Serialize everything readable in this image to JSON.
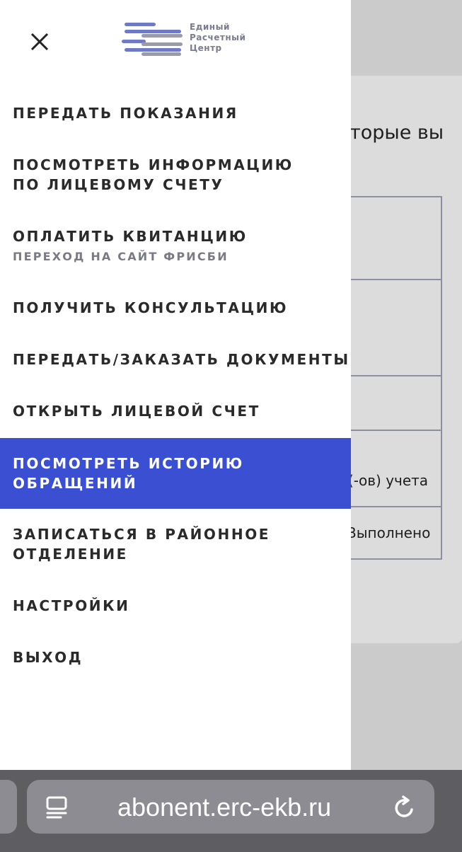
{
  "background": {
    "partial_text": "торые вы",
    "cells": [
      "(-ов) учета",
      "Выполнено"
    ]
  },
  "logo": {
    "line1": "Единый",
    "line2": "Расчетный",
    "line3": "Центр"
  },
  "menu": {
    "items": [
      {
        "label": "ПЕРЕДАТЬ ПОКАЗАНИЯ"
      },
      {
        "label": "ПОСМОТРЕТЬ ИНФОРМАЦИЮ ПО ЛИЦЕВОМУ СЧЕТУ"
      },
      {
        "label": "ОПЛАТИТЬ КВИТАНЦИЮ",
        "sub": "ПЕРЕХОД НА САЙТ ФРИСБИ"
      },
      {
        "label": "ПОЛУЧИТЬ КОНСУЛЬТАЦИЮ"
      },
      {
        "label": "ПЕРЕДАТЬ/ЗАКАЗАТЬ ДОКУМЕНТЫ"
      },
      {
        "label": "ОТКРЫТЬ ЛИЦЕВОЙ СЧЕТ"
      },
      {
        "label": "ПОСМОТРЕТЬ ИСТОРИЮ ОБРАЩЕНИЙ",
        "active": true
      },
      {
        "label": "ЗАПИСАТЬСЯ В РАЙОННОЕ ОТДЕЛЕНИЕ"
      },
      {
        "label": "НАСТРОЙКИ"
      },
      {
        "label": "ВЫХОД"
      }
    ]
  },
  "browser": {
    "url": "abonent.erc-ekb.ru"
  },
  "colors": {
    "active_item": "#3a4fd1",
    "logo_stripes_blue": "#6f79c6",
    "logo_stripes_gray": "#9b9ba8"
  }
}
